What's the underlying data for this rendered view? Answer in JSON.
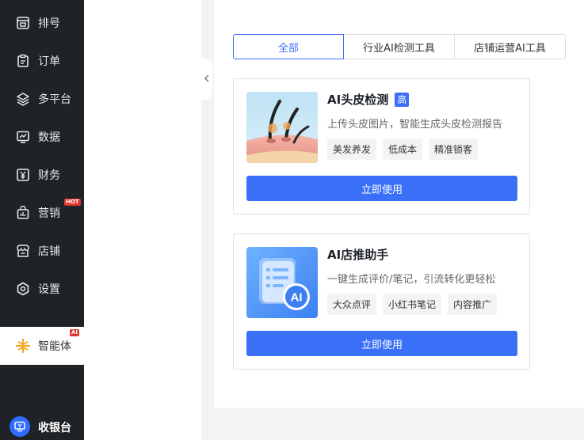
{
  "sidebar": {
    "items": [
      {
        "label": "排号",
        "icon": "queue-icon"
      },
      {
        "label": "订单",
        "icon": "clipboard-icon"
      },
      {
        "label": "多平台",
        "icon": "layers-icon"
      },
      {
        "label": "数据",
        "icon": "chart-monitor-icon"
      },
      {
        "label": "财务",
        "icon": "yen-icon"
      },
      {
        "label": "营销",
        "icon": "bag-chart-icon"
      },
      {
        "label": "店铺",
        "icon": "store-icon"
      },
      {
        "label": "设置",
        "icon": "settings-icon"
      },
      {
        "label": "智能体",
        "icon": "ai-agent-icon"
      }
    ],
    "badges": {
      "hot": "HOT",
      "ai": "AI"
    },
    "cashier_label": "收银台"
  },
  "tabs": [
    "全部",
    "行业AI检测工具",
    "店铺运营AI工具"
  ],
  "cards": [
    {
      "title": "AI头皮检测",
      "level_tag": "高",
      "description": "上传头皮图片，智能生成头皮检测报告",
      "tags": [
        "美发养发",
        "低成本",
        "精准锁客"
      ],
      "button": "立即使用"
    },
    {
      "title": "AI店推助手",
      "description": "一键生成评价/笔记，引流转化更轻松",
      "tags": [
        "大众点评",
        "小红书笔记",
        "内容推广"
      ],
      "button": "立即使用",
      "thumb_text": "AI"
    }
  ],
  "colors": {
    "accent": "#3a6ff7",
    "sidebar": "#1f2226",
    "hot_badge": "#e2352b"
  }
}
